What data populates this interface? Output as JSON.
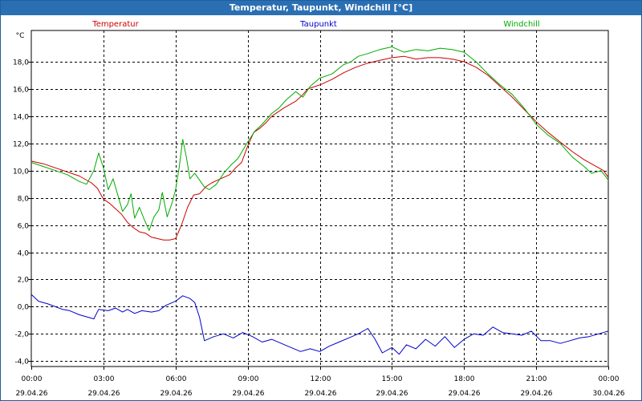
{
  "window": {
    "title": "Temperatur, Taupunkt, Windchill [°C]"
  },
  "chart_data": {
    "type": "line",
    "y_unit": "°C",
    "ylim": [
      -4.5,
      20.5
    ],
    "y_ticks": [
      -4.0,
      -2.0,
      0.0,
      2.0,
      4.0,
      6.0,
      8.0,
      10.0,
      12.0,
      14.0,
      16.0,
      18.0
    ],
    "y_tick_labels": [
      "-4,0",
      "-2,0",
      "0,0",
      "2,0",
      "4,0",
      "6,0",
      "8,0",
      "10,0",
      "12,0",
      "14,0",
      "16,0",
      "18,0"
    ],
    "xlim": [
      0,
      24
    ],
    "x_ticks": [
      0,
      3,
      6,
      9,
      12,
      15,
      18,
      21,
      24
    ],
    "x_tick_labels": [
      [
        "00:00",
        "29.04.26"
      ],
      [
        "03:00",
        "29.04.26"
      ],
      [
        "06:00",
        "29.04.26"
      ],
      [
        "09:00",
        "29.04.26"
      ],
      [
        "12:00",
        "29.04.26"
      ],
      [
        "15:00",
        "29.04.26"
      ],
      [
        "18:00",
        "29.04.26"
      ],
      [
        "21:00",
        "29.04.26"
      ],
      [
        "00:00",
        "30.04.26"
      ]
    ],
    "grid": true,
    "legend_position": "top",
    "series": [
      {
        "name": "Temperatur",
        "color": "#cc0000",
        "points": [
          [
            0,
            10.7
          ],
          [
            0.5,
            10.5
          ],
          [
            1,
            10.2
          ],
          [
            1.5,
            9.9
          ],
          [
            2,
            9.6
          ],
          [
            2.5,
            9.1
          ],
          [
            2.75,
            8.7
          ],
          [
            3,
            7.9
          ],
          [
            3.25,
            7.6
          ],
          [
            3.5,
            7.2
          ],
          [
            3.75,
            6.8
          ],
          [
            4,
            6.2
          ],
          [
            4.25,
            5.8
          ],
          [
            4.5,
            5.5
          ],
          [
            4.75,
            5.4
          ],
          [
            5,
            5.1
          ],
          [
            5.25,
            5.0
          ],
          [
            5.5,
            4.9
          ],
          [
            5.75,
            4.9
          ],
          [
            6,
            5.0
          ],
          [
            6.25,
            6.0
          ],
          [
            6.5,
            7.3
          ],
          [
            6.75,
            8.2
          ],
          [
            7,
            8.3
          ],
          [
            7.25,
            8.8
          ],
          [
            7.5,
            9.1
          ],
          [
            7.75,
            9.3
          ],
          [
            8,
            9.5
          ],
          [
            8.25,
            9.7
          ],
          [
            8.5,
            10.2
          ],
          [
            8.75,
            10.6
          ],
          [
            9,
            11.8
          ],
          [
            9.25,
            12.8
          ],
          [
            9.5,
            13.1
          ],
          [
            9.75,
            13.5
          ],
          [
            10,
            14.0
          ],
          [
            10.5,
            14.6
          ],
          [
            11,
            15.1
          ],
          [
            11.25,
            15.5
          ],
          [
            11.5,
            16.0
          ],
          [
            12,
            16.3
          ],
          [
            12.5,
            16.7
          ],
          [
            13,
            17.2
          ],
          [
            13.5,
            17.6
          ],
          [
            14,
            17.9
          ],
          [
            14.5,
            18.1
          ],
          [
            15,
            18.3
          ],
          [
            15.5,
            18.4
          ],
          [
            16,
            18.2
          ],
          [
            16.5,
            18.3
          ],
          [
            17,
            18.3
          ],
          [
            17.5,
            18.2
          ],
          [
            18,
            18.0
          ],
          [
            18.5,
            17.6
          ],
          [
            19,
            17.0
          ],
          [
            19.5,
            16.2
          ],
          [
            20,
            15.4
          ],
          [
            20.5,
            14.5
          ],
          [
            21,
            13.6
          ],
          [
            21.5,
            12.8
          ],
          [
            22,
            12.1
          ],
          [
            22.5,
            11.4
          ],
          [
            23,
            10.8
          ],
          [
            23.5,
            10.3
          ],
          [
            23.8,
            10.0
          ],
          [
            24,
            9.5
          ]
        ]
      },
      {
        "name": "Taupunkt",
        "color": "#0000cc",
        "points": [
          [
            0,
            0.9
          ],
          [
            0.3,
            0.4
          ],
          [
            0.7,
            0.2
          ],
          [
            1,
            0.0
          ],
          [
            1.3,
            -0.2
          ],
          [
            1.6,
            -0.3
          ],
          [
            2,
            -0.6
          ],
          [
            2.4,
            -0.8
          ],
          [
            2.6,
            -0.9
          ],
          [
            2.8,
            -0.2
          ],
          [
            3.2,
            -0.3
          ],
          [
            3.5,
            -0.1
          ],
          [
            3.8,
            -0.4
          ],
          [
            4,
            -0.2
          ],
          [
            4.3,
            -0.5
          ],
          [
            4.6,
            -0.3
          ],
          [
            5,
            -0.4
          ],
          [
            5.3,
            -0.3
          ],
          [
            5.6,
            0.1
          ],
          [
            6,
            0.4
          ],
          [
            6.3,
            0.8
          ],
          [
            6.6,
            0.6
          ],
          [
            6.8,
            0.3
          ],
          [
            7,
            -0.8
          ],
          [
            7.2,
            -2.5
          ],
          [
            7.6,
            -2.2
          ],
          [
            8,
            -2.0
          ],
          [
            8.4,
            -2.3
          ],
          [
            8.8,
            -1.9
          ],
          [
            9.2,
            -2.2
          ],
          [
            9.6,
            -2.6
          ],
          [
            10,
            -2.4
          ],
          [
            10.4,
            -2.7
          ],
          [
            10.8,
            -3.0
          ],
          [
            11.2,
            -3.3
          ],
          [
            11.6,
            -3.1
          ],
          [
            12,
            -3.3
          ],
          [
            12.4,
            -2.9
          ],
          [
            12.8,
            -2.6
          ],
          [
            13.2,
            -2.3
          ],
          [
            13.6,
            -2.0
          ],
          [
            14,
            -1.6
          ],
          [
            14.3,
            -2.4
          ],
          [
            14.6,
            -3.4
          ],
          [
            15,
            -3.0
          ],
          [
            15.3,
            -3.5
          ],
          [
            15.6,
            -2.8
          ],
          [
            16,
            -3.1
          ],
          [
            16.4,
            -2.4
          ],
          [
            16.8,
            -2.9
          ],
          [
            17.2,
            -2.2
          ],
          [
            17.6,
            -3.0
          ],
          [
            18,
            -2.4
          ],
          [
            18.4,
            -2.0
          ],
          [
            18.8,
            -2.1
          ],
          [
            19.2,
            -1.5
          ],
          [
            19.6,
            -1.9
          ],
          [
            20,
            -2.0
          ],
          [
            20.4,
            -2.1
          ],
          [
            20.8,
            -1.8
          ],
          [
            21.2,
            -2.5
          ],
          [
            21.6,
            -2.5
          ],
          [
            22,
            -2.7
          ],
          [
            22.4,
            -2.5
          ],
          [
            22.8,
            -2.3
          ],
          [
            23.2,
            -2.2
          ],
          [
            23.6,
            -2.0
          ],
          [
            24,
            -1.8
          ]
        ]
      },
      {
        "name": "Windchill",
        "color": "#00aa00",
        "points": [
          [
            0,
            10.6
          ],
          [
            0.5,
            10.3
          ],
          [
            1,
            10.0
          ],
          [
            1.5,
            9.7
          ],
          [
            2,
            9.2
          ],
          [
            2.3,
            9.0
          ],
          [
            2.6,
            10.0
          ],
          [
            2.8,
            11.3
          ],
          [
            3,
            10.2
          ],
          [
            3.2,
            8.6
          ],
          [
            3.4,
            9.4
          ],
          [
            3.6,
            8.2
          ],
          [
            3.8,
            7.0
          ],
          [
            4,
            7.5
          ],
          [
            4.15,
            8.3
          ],
          [
            4.3,
            6.5
          ],
          [
            4.5,
            7.3
          ],
          [
            4.7,
            6.4
          ],
          [
            4.9,
            5.6
          ],
          [
            5.1,
            6.6
          ],
          [
            5.3,
            7.1
          ],
          [
            5.45,
            8.4
          ],
          [
            5.65,
            6.6
          ],
          [
            5.85,
            7.6
          ],
          [
            6,
            8.6
          ],
          [
            6.15,
            10.2
          ],
          [
            6.3,
            12.3
          ],
          [
            6.45,
            11.0
          ],
          [
            6.6,
            9.4
          ],
          [
            6.8,
            9.8
          ],
          [
            7,
            9.3
          ],
          [
            7.2,
            8.8
          ],
          [
            7.4,
            8.6
          ],
          [
            7.7,
            9.0
          ],
          [
            8,
            9.8
          ],
          [
            8.3,
            10.4
          ],
          [
            8.6,
            10.9
          ],
          [
            9,
            12.1
          ],
          [
            9.3,
            12.9
          ],
          [
            9.6,
            13.4
          ],
          [
            10,
            14.2
          ],
          [
            10.3,
            14.6
          ],
          [
            10.6,
            15.2
          ],
          [
            11,
            15.8
          ],
          [
            11.3,
            15.4
          ],
          [
            11.6,
            16.2
          ],
          [
            12,
            16.8
          ],
          [
            12.5,
            17.1
          ],
          [
            13,
            17.8
          ],
          [
            13.3,
            18.0
          ],
          [
            13.6,
            18.4
          ],
          [
            14,
            18.6
          ],
          [
            14.5,
            18.9
          ],
          [
            15,
            19.1
          ],
          [
            15.5,
            18.7
          ],
          [
            16,
            18.9
          ],
          [
            16.5,
            18.8
          ],
          [
            17,
            19.0
          ],
          [
            17.5,
            18.9
          ],
          [
            18,
            18.7
          ],
          [
            18.5,
            18.0
          ],
          [
            19,
            17.1
          ],
          [
            19.5,
            16.3
          ],
          [
            20,
            15.6
          ],
          [
            20.5,
            14.6
          ],
          [
            21,
            13.4
          ],
          [
            21.5,
            12.6
          ],
          [
            22,
            12.0
          ],
          [
            22.5,
            11.0
          ],
          [
            23,
            10.3
          ],
          [
            23.3,
            9.8
          ],
          [
            23.7,
            10.0
          ],
          [
            24,
            9.3
          ]
        ]
      }
    ]
  }
}
